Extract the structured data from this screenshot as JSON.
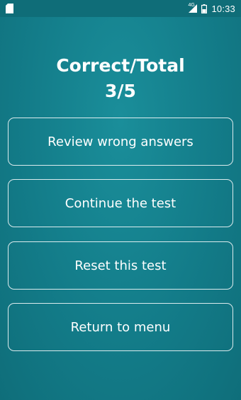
{
  "status_bar": {
    "network_type": "4G",
    "time": "10:33",
    "icons": [
      "sd-card-icon",
      "signal-icon",
      "battery-icon"
    ]
  },
  "result": {
    "title": "Correct/Total",
    "score": "3/5"
  },
  "buttons": {
    "review": "Review wrong answers",
    "continue": "Continue the test",
    "reset": "Reset this test",
    "return": "Return to menu"
  },
  "colors": {
    "background": "#147f8c",
    "status_bar": "#0f6d78",
    "text": "#ffffff",
    "button_border": "#ffffff"
  }
}
